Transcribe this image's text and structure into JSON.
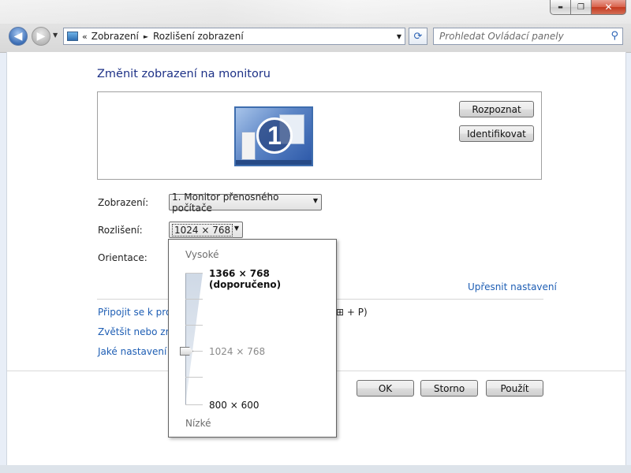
{
  "window": {
    "controls": {
      "minimize": "▬",
      "maximize": "❐",
      "close": "✕"
    }
  },
  "nav": {
    "back_icon": "arrow-left-icon",
    "forward_icon": "arrow-right-icon"
  },
  "address": {
    "prefix": "«",
    "crumbs": [
      "Zobrazení",
      "Rozlišení zobrazení"
    ],
    "separator": "►"
  },
  "search": {
    "placeholder": "Prohledat Ovládací panely"
  },
  "page": {
    "title": "Změnit zobrazení na monitoru",
    "monitor_number": "1",
    "detect_button": "Rozpoznat",
    "identify_button": "Identifikovat"
  },
  "settings": {
    "display_label": "Zobrazení:",
    "display_value": "1. Monitor přenosného počítače",
    "resolution_label": "Rozlišení:",
    "resolution_value": "1024 × 768",
    "orientation_label": "Orientace:"
  },
  "links": {
    "advanced": "Upřesnit nastavení",
    "projector": "Připojit se k proje",
    "projector_hotkey": "+ P)",
    "text_size": "Zvětšit nebo zme",
    "which": "Jaké nastavení m"
  },
  "footer": {
    "ok": "OK",
    "cancel": "Storno",
    "apply": "Použít"
  },
  "resolution_popup": {
    "high_label": "Vysoké",
    "low_label": "Nízké",
    "options": [
      "1366 × 768 (doporučeno)",
      "1024 × 768",
      "800 × 600"
    ],
    "selected_index": 1
  },
  "colors": {
    "title": "#1e3287",
    "link": "#1e5eb4",
    "close_button": "#c4391f"
  }
}
